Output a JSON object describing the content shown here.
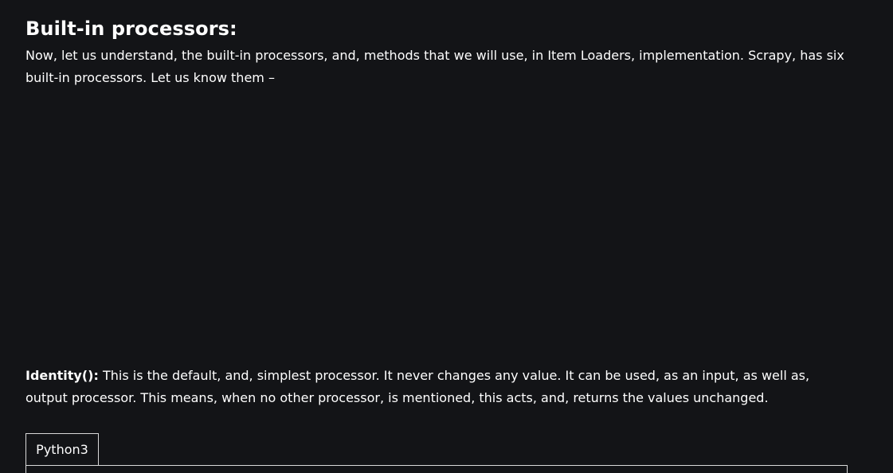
{
  "article": {
    "heading": "Built-in processors:",
    "intro": "Now, let us understand, the built-in processors, and, methods that we will use, in Item Loaders, implementation. Scrapy, has six built-in processors. Let us know them –",
    "identity_label": "Identity():",
    "identity_text": " This is the default, and, simplest processor. It never changes any value. It can be used, as an input, as well as, output processor. This means, when no other processor, is mentioned, this acts, and, returns the values unchanged."
  },
  "code_block": {
    "tab_label": "Python3"
  }
}
